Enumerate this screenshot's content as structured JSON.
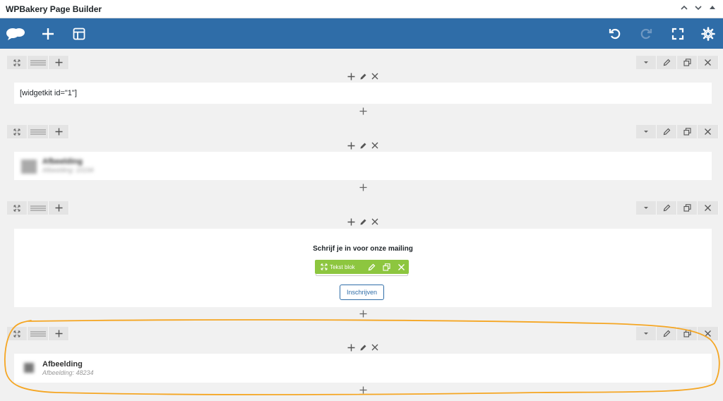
{
  "window": {
    "title": "WPBakery Page Builder"
  },
  "toolbar": {
    "icons": [
      "logo-icon",
      "add-icon",
      "templates-icon",
      "undo-icon",
      "redo-icon",
      "fullscreen-icon",
      "settings-icon"
    ]
  },
  "rows": [
    {
      "shortcode": "[widgetkit id=\"1\"]"
    },
    {
      "title": "Afbeelding",
      "subtitle": "Afbeelding: 10194"
    },
    {
      "heading": "Schrijf je in voor onze mailing",
      "element_label": "Tekst blok",
      "button_label": "Inschrijven"
    },
    {
      "title": "Afbeelding",
      "subtitle": "Afbeelding: 48234"
    }
  ],
  "colors": {
    "toolbar": "#2f6da8",
    "green": "#8dc63f",
    "highlight": "#f5a623"
  }
}
